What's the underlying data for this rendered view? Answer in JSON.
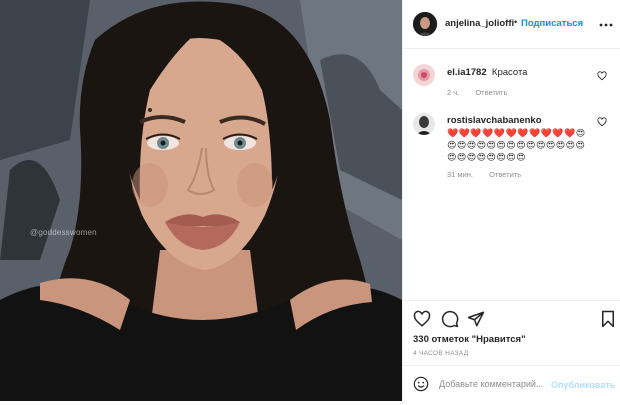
{
  "photo": {
    "watermark": "@goddesswomen",
    "colors": {
      "hair": "#1b1512",
      "skin": "#d8a88e",
      "lips": "#b5695d",
      "top": "#121212"
    }
  },
  "header": {
    "username": "anjelina_jolioffi",
    "dot": "•",
    "follow_label": "Подписаться",
    "more_icon": "more-horizontal-icon"
  },
  "comments": [
    {
      "username": "el.ia1782",
      "text": "Красота",
      "time": "2 ч.",
      "reply": "Ответить"
    },
    {
      "username": "rostislavchabanenko",
      "emojis": "❤️❤️❤️❤️❤️❤️❤️❤️❤️❤️❤️😍😍😍😍😍😍😍😍😍😍😍😍😍😍😍😍😍😍😍😍😍😍😍",
      "time": "31 мин.",
      "reply": "Ответить"
    }
  ],
  "actions": {
    "likes": "330 отметок \"Нравится\"",
    "time": "4 ЧАСОВ НАЗАД",
    "comment_placeholder": "Добавьте комментарий...",
    "publish_label": "Опубликовать"
  },
  "colors": {
    "accent": "#0095f6",
    "muted": "#8e8e8e",
    "border": "#efefef"
  }
}
